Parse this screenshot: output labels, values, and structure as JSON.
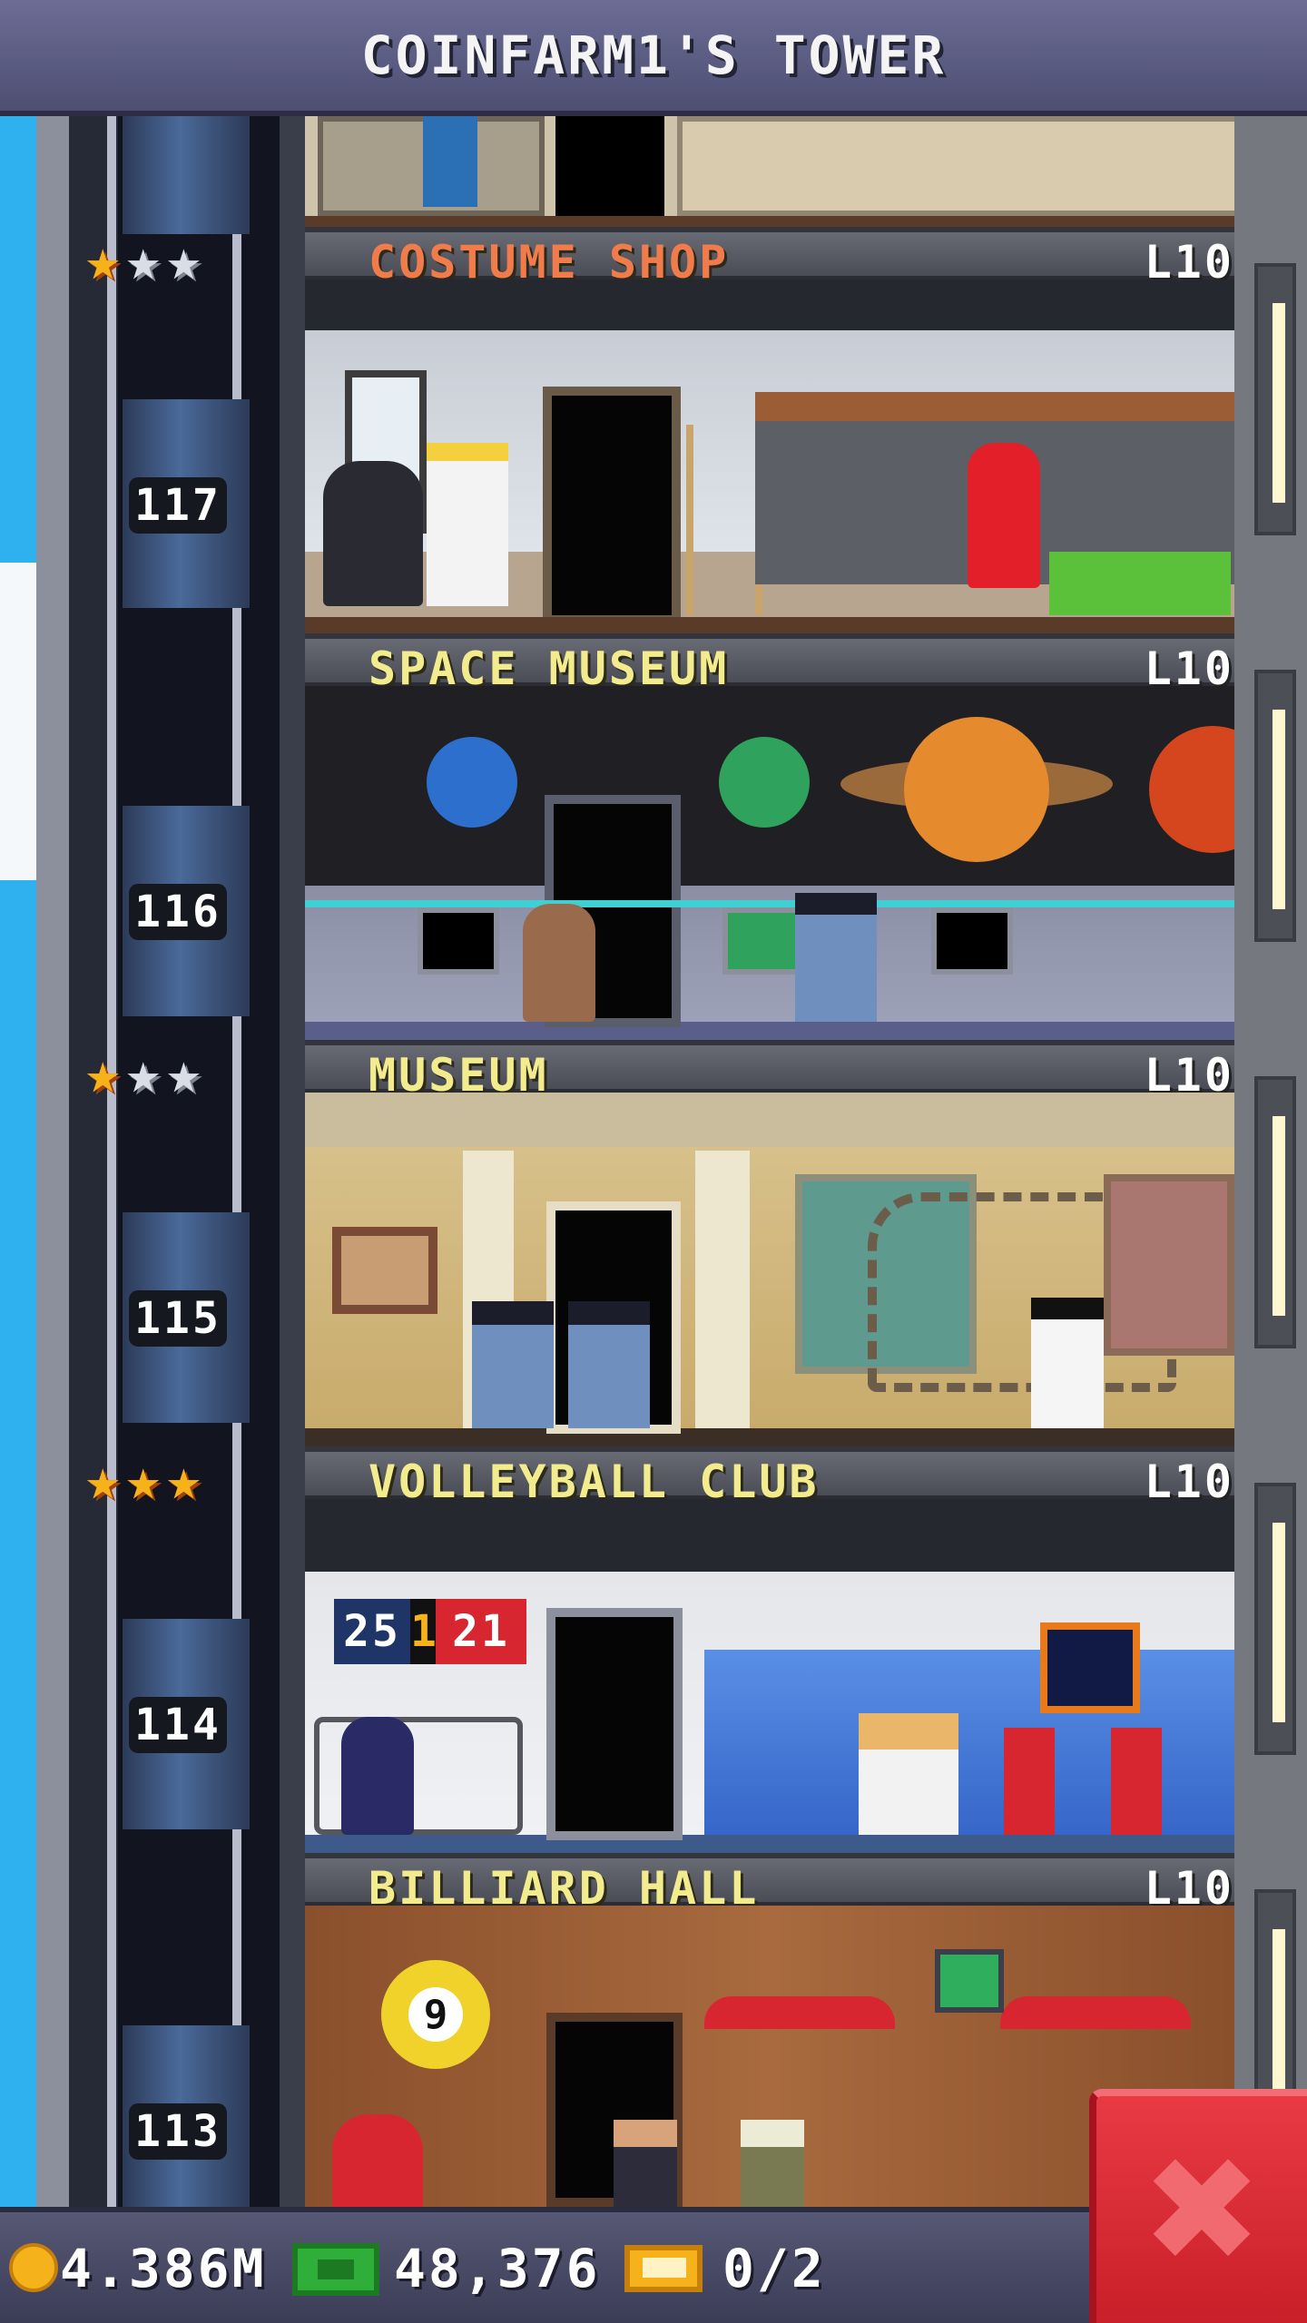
{
  "header": {
    "title": "COINFARM1'S TOWER"
  },
  "floors": [
    {
      "name": "COSTUME SHOP",
      "level": "L10",
      "number": "117",
      "name_color": "#f07c4c",
      "stars": [
        "gold",
        "silver",
        "silver"
      ]
    },
    {
      "name": "SPACE MUSEUM",
      "level": "L10",
      "number": "116",
      "name_color": "#f3ec8e",
      "stars": []
    },
    {
      "name": "MUSEUM",
      "level": "L10",
      "number": "115",
      "name_color": "#f3ec8e",
      "stars": [
        "gold",
        "silver",
        "silver"
      ]
    },
    {
      "name": "VOLLEYBALL CLUB",
      "level": "L10",
      "number": "114",
      "name_color": "#f3ec8e",
      "stars": [
        "gold",
        "gold",
        "gold"
      ]
    },
    {
      "name": "BILLIARD HALL",
      "level": "L10",
      "number": "113",
      "name_color": "#f3ec8e",
      "stars": []
    }
  ],
  "volleyball_score": {
    "home": "25",
    "set": "1",
    "away": "21"
  },
  "billiard_ball": "9",
  "status": {
    "coins": "4.386M",
    "bux": "48,376",
    "tickets": "0/2"
  },
  "icons": {
    "coin": "coin-icon",
    "bux": "tower-bux-icon",
    "ticket": "vip-ticket-icon",
    "close": "close-icon",
    "star": "star-icon"
  },
  "colors": {
    "accent_red": "#d7262f",
    "gold_star": "#f5b21a",
    "sky": "#2fb0ef"
  }
}
